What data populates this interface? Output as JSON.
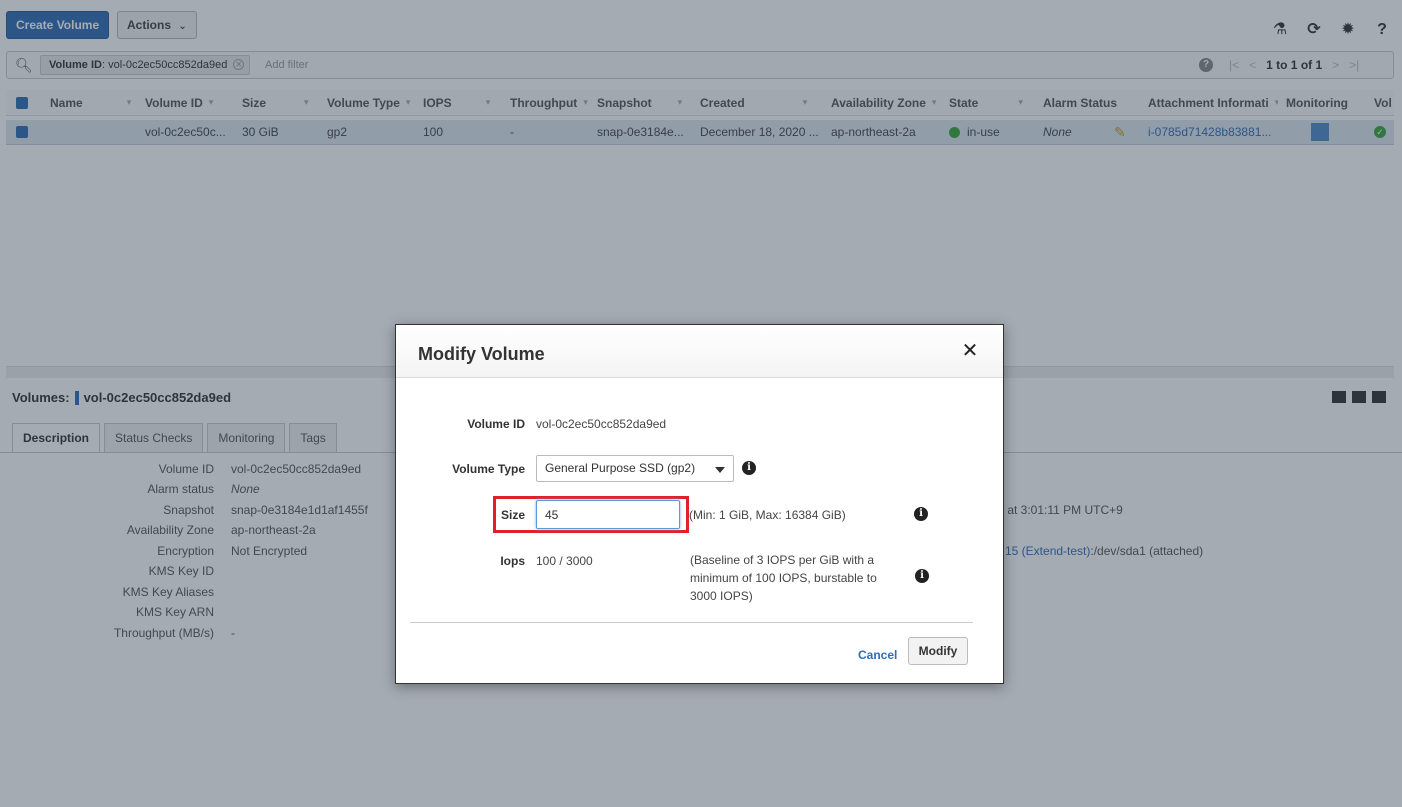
{
  "toolbar": {
    "create_label": "Create Volume",
    "actions_label": "Actions",
    "actions_caret": "⌄",
    "icons": [
      "flask-icon",
      "refresh-icon",
      "gear-icon",
      "help-icon"
    ],
    "icon_glyphs": [
      "⚗",
      "⟳",
      "✹",
      "?"
    ]
  },
  "filter": {
    "chip_key": "Volume ID",
    "chip_value": ": vol-0c2ec50cc852da9ed",
    "add_placeholder": "Add filter",
    "help_glyph": "?",
    "pager_first": "|<",
    "pager_prev": "<",
    "pager_count": "1 to 1 of 1",
    "pager_next": ">",
    "pager_last": ">|"
  },
  "grid": {
    "headers": [
      "Name",
      "Volume ID",
      "Size",
      "Volume Type",
      "IOPS",
      "Throughput",
      "Snapshot",
      "Created",
      "Availability Zone",
      "State",
      "Alarm Status",
      "Attachment Informati",
      "Monitoring",
      "Vol"
    ],
    "row": {
      "name": "",
      "volume_id": "vol-0c2ec50c...",
      "size": "30 GiB",
      "volume_type": "gp2",
      "iops": "100",
      "throughput": "-",
      "snapshot": "snap-0e3184e...",
      "created": "December 18, 2020 ...",
      "availability_zone": "ap-northeast-2a",
      "state": "in-use",
      "alarm_status": "None",
      "attachment": "i-0785d71428b83881..."
    }
  },
  "detail": {
    "title_prefix": "Volumes:",
    "title_volume": "vol-0c2ec50cc852da9ed",
    "tabs": [
      "Description",
      "Status Checks",
      "Monitoring",
      "Tags"
    ],
    "props": [
      {
        "k": "Volume ID",
        "v": "vol-0c2ec50cc852da9ed"
      },
      {
        "k": "Alarm status",
        "v": "None"
      },
      {
        "k": "Snapshot",
        "v": "snap-0e3184e1d1af1455f"
      },
      {
        "k": "Availability Zone",
        "v": "ap-northeast-2a"
      },
      {
        "k": "Encryption",
        "v": "Not Encrypted"
      },
      {
        "k": "KMS Key ID",
        "v": ""
      },
      {
        "k": "KMS Key Aliases",
        "v": ""
      },
      {
        "k": "KMS Key ARN",
        "v": ""
      },
      {
        "k": "Throughput (MB/s)",
        "v": "-"
      }
    ],
    "created_peek": ") at 3:01:11 PM UTC+9",
    "attachment_link": "15 (Extend-test)",
    "attachment_rest": ":/dev/sda1 (attached)"
  },
  "modal": {
    "title": "Modify Volume",
    "close_glyph": "✕",
    "volume_id_label": "Volume ID",
    "volume_id_value": "vol-0c2ec50cc852da9ed",
    "volume_type_label": "Volume Type",
    "volume_type_value": "General Purpose SSD (gp2)",
    "size_label": "Size",
    "size_value": "45",
    "size_hint": "(Min: 1 GiB, Max: 16384 GiB)",
    "iops_label": "Iops",
    "iops_value": "100 / 3000",
    "iops_hint": "(Baseline of 3 IOPS per GiB with a minimum of 100 IOPS, burstable to 3000 IOPS)",
    "info_glyph": "i",
    "cancel_label": "Cancel",
    "modify_label": "Modify"
  },
  "colors": {
    "primary": "#2f6db5",
    "highlight": "#e0202a",
    "in_use": "#3aa63a"
  }
}
